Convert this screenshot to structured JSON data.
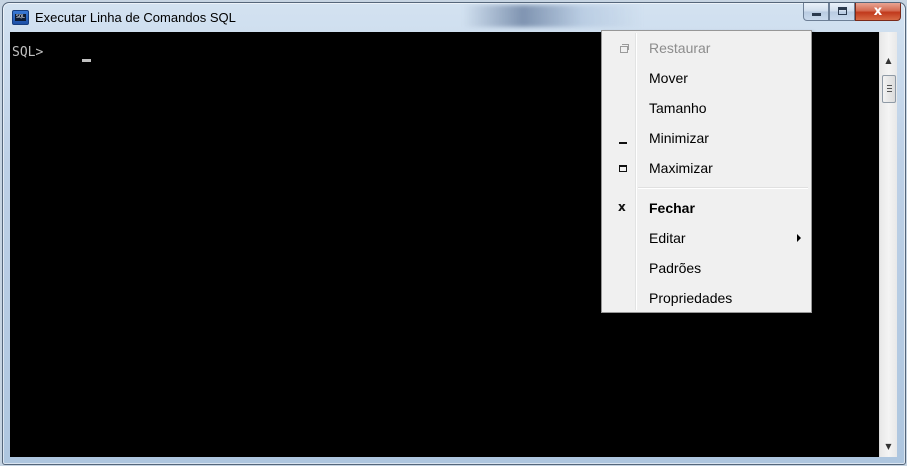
{
  "window": {
    "title": "Executar Linha de Comandos SQL",
    "icon": "sql-console-icon",
    "icon_text": "SQL"
  },
  "console": {
    "prompt": "SQL> ",
    "background_color": "#000000",
    "text_color": "#c0c0c0"
  },
  "system_menu": {
    "items": [
      {
        "label": "Restaurar",
        "icon": "restore-icon",
        "enabled": false
      },
      {
        "label": "Mover",
        "icon": "",
        "enabled": true
      },
      {
        "label": "Tamanho",
        "icon": "",
        "enabled": true
      },
      {
        "label": "Minimizar",
        "icon": "minimize-icon",
        "enabled": true
      },
      {
        "label": "Maximizar",
        "icon": "maximize-icon",
        "enabled": true
      },
      {
        "label": "Fechar",
        "icon": "close-icon",
        "enabled": true,
        "bold": true
      },
      {
        "label": "Editar",
        "icon": "",
        "enabled": true,
        "submenu": true
      },
      {
        "label": "Padrões",
        "icon": "",
        "enabled": true
      },
      {
        "label": "Propriedades",
        "icon": "",
        "enabled": true
      }
    ]
  },
  "caption_buttons": {
    "close_glyph": "x"
  }
}
